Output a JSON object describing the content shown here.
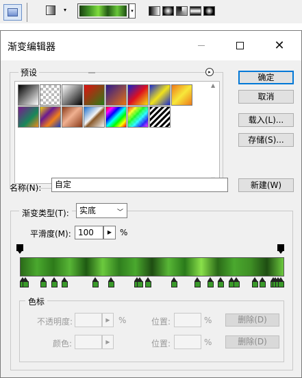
{
  "toolbar": {
    "tool_icon": "gradient-tool-icon",
    "gradient_preview_colors": [
      "#1a3f10",
      "#3f8f25",
      "#7fdc3f",
      "#245a16",
      "#69c63a",
      "#1e4d12"
    ],
    "dropdown_arrow": "▾",
    "types": [
      "linear",
      "radial",
      "angle",
      "reflected",
      "diamond"
    ]
  },
  "dialog": {
    "title": "渐变编辑器",
    "window_controls": {
      "minimize": "—",
      "maximize": "☐",
      "close": "✕"
    }
  },
  "presets": {
    "label": "预设",
    "menu_icon": "▸",
    "swatches": [
      {
        "name": "black-white",
        "css": "linear-gradient(135deg,#000 0%,#fff 100%)"
      },
      {
        "name": "checker-transparent",
        "css": "repeating-conic-gradient(#bbb 0% 25%, #fff 0% 50%) 0 0/8px 8px"
      },
      {
        "name": "black-white-2",
        "css": "linear-gradient(135deg,#fff 0%,#000 100%)"
      },
      {
        "name": "red-green",
        "css": "linear-gradient(135deg,#e01010 0%,#2a7d18 100%)"
      },
      {
        "name": "violet-orange",
        "css": "linear-gradient(135deg,#2b1a8f 0%,#e87210 100%)"
      },
      {
        "name": "blue-red-yellow",
        "css": "linear-gradient(135deg,#1122cc 0%,#dd1020 50%,#f5e10f 100%)"
      },
      {
        "name": "blue-yellow-blue",
        "css": "linear-gradient(135deg,#1a2bd0 0%,#f0e21c 50%,#1a2bd0 100%)"
      },
      {
        "name": "orange-yellow-orange",
        "css": "linear-gradient(135deg,#ee7a1a 0%,#f7e83a 50%,#ee7a1a 100%)"
      },
      {
        "name": "violet-green-orange",
        "css": "linear-gradient(135deg,#7a1a8f 0%,#17885a 60%,#f08a1a 100%)"
      },
      {
        "name": "yellow-violet-orange-blue",
        "css": "linear-gradient(135deg,#f0d10f 0%,#6a1a8f 35%,#f0801a 65%,#1a3fc0 100%)"
      },
      {
        "name": "copper",
        "css": "linear-gradient(135deg,#8a3b1a 0%,#f0b090 45%,#8a3b1a 100%)"
      },
      {
        "name": "chrome",
        "css": "linear-gradient(135deg,#1a6fd0 0%,#f4f4f4 45%,#8a5a2a 55%,#f4f4f4 100%)"
      },
      {
        "name": "spectrum",
        "css": "linear-gradient(135deg,#ff0000,#ff00ff,#0000ff,#00ffff,#00ff00,#ffff00,#ff0000)"
      },
      {
        "name": "transparent-rainbow",
        "css": "linear-gradient(135deg,rgba(255,0,0,0.8),rgba(255,255,0,0.8),rgba(0,255,0,0.8),rgba(0,255,255,0.8),rgba(0,0,255,0.8),rgba(255,0,255,0.8)), repeating-conic-gradient(#ccc 0% 25%, #fff 0% 50%) 0 0/8px 8px"
      },
      {
        "name": "transparent-stripes",
        "css": "repeating-linear-gradient(135deg,#000 0 3px,#fff 3px 6px)"
      }
    ]
  },
  "buttons": {
    "ok": "确定",
    "cancel": "取消",
    "load": "载入(L)...",
    "save": "存储(S)...",
    "new": "新建(W)"
  },
  "name_row": {
    "label": "名称(N):",
    "value": "自定"
  },
  "gradient_type": {
    "label": "渐变类型(T):",
    "selected": "实底",
    "smoothness_label": "平滑度(M):",
    "smoothness_value": "100",
    "smoothness_unit": "%"
  },
  "gradient": {
    "colors": [
      "#2a6a18",
      "#4aa82e",
      "#2d7a1a",
      "#58b636",
      "#1e5a12",
      "#6cca3e",
      "#2f7e1e",
      "#4aa82e",
      "#1e4d12",
      "#58b636",
      "#2a7a1a",
      "#8ae04a",
      "#2a6a18",
      "#4aa82e",
      "#3f8f25",
      "#1e4d12",
      "#6cca3e"
    ],
    "opacity_stop_count": 2,
    "color_stop_positions": [
      1,
      2,
      9,
      13,
      17,
      29,
      35,
      45,
      46,
      49,
      59,
      68,
      73,
      77,
      81,
      83,
      90,
      93,
      97,
      98,
      99,
      100
    ]
  },
  "color_stops": {
    "group_label": "色标",
    "opacity_label": "不透明度:",
    "opacity_unit": "%",
    "location_label": "位置:",
    "location_unit": "%",
    "delete_label": "删除(D)",
    "color_label": "颜色:",
    "location_label_2": "位置:",
    "location_unit_2": "%",
    "delete_label_2": "删除(D)"
  }
}
